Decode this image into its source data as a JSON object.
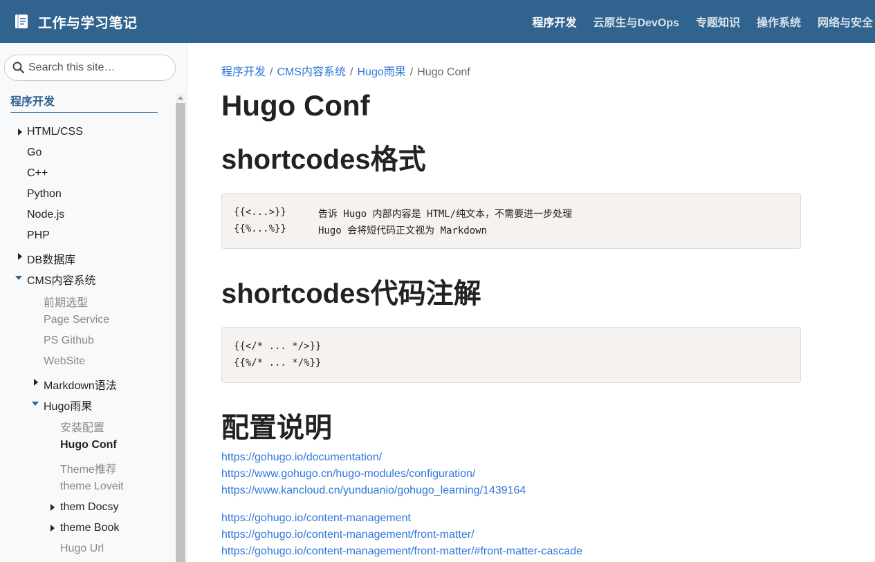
{
  "navbar": {
    "brand_title": "工作与学习笔记",
    "brand_icon": "notebook-icon",
    "links": [
      "程序开发",
      "云原生与DevOps",
      "专题知识",
      "操作系统",
      "网络与安全"
    ]
  },
  "sidebar": {
    "search_placeholder": "Search this site…",
    "section_title": "程序开发",
    "items": [
      {
        "label": "HTML/CSS"
      },
      {
        "label": "Go"
      },
      {
        "label": "C++"
      },
      {
        "label": "Python"
      },
      {
        "label": "Node.js"
      },
      {
        "label": "PHP"
      },
      {
        "label": "DB数据库"
      },
      {
        "label": "CMS内容系统"
      },
      {
        "label": "前期选型"
      },
      {
        "label": "Page Service"
      },
      {
        "label": "PS Github"
      },
      {
        "label": "WebSite"
      },
      {
        "label": "Markdown语法"
      },
      {
        "label": "Hugo雨果"
      },
      {
        "label": "安装配置"
      },
      {
        "label": "Hugo Conf"
      },
      {
        "label": "Theme推荐"
      },
      {
        "label": "theme Loveit"
      },
      {
        "label": "them Docsy"
      },
      {
        "label": "theme Book"
      },
      {
        "label": "Hugo Url"
      }
    ]
  },
  "breadcrumb": {
    "items": [
      "程序开发",
      "CMS内容系统",
      "Hugo雨果"
    ],
    "current": "Hugo Conf",
    "separator": "/"
  },
  "content": {
    "title": "Hugo Conf",
    "sections": [
      {
        "heading": "shortcodes格式",
        "code": [
          {
            "code": "{{<...>}}",
            "desc": "告诉 Hugo 内部内容是 HTML/纯文本，不需要进一步处理"
          },
          {
            "code": "{{%...%}}",
            "desc": "Hugo 会将短代码正文视为 Markdown"
          }
        ]
      },
      {
        "heading": "shortcodes代码注解",
        "code": [
          {
            "code": "{{</* ... */>}}",
            "desc": ""
          },
          {
            "code": "{{%/* ... */%}}",
            "desc": ""
          }
        ]
      },
      {
        "heading": "配置说明",
        "links": [
          "https://gohugo.io/documentation/",
          "https://www.gohugo.cn/hugo-modules/configuration/",
          "https://www.kancloud.cn/yunduanio/gohugo_learning/1439164",
          "https://gohugo.io/content-management",
          "https://gohugo.io/content-management/front-matter/",
          "https://gohugo.io/content-management/front-matter/#front-matter-cascade"
        ]
      }
    ]
  },
  "colors": {
    "navbar_bg": "#30638e",
    "link": "#3176d9",
    "code_bg": "#f5f2f0",
    "sidebar_bg": "#f8f9fa"
  }
}
